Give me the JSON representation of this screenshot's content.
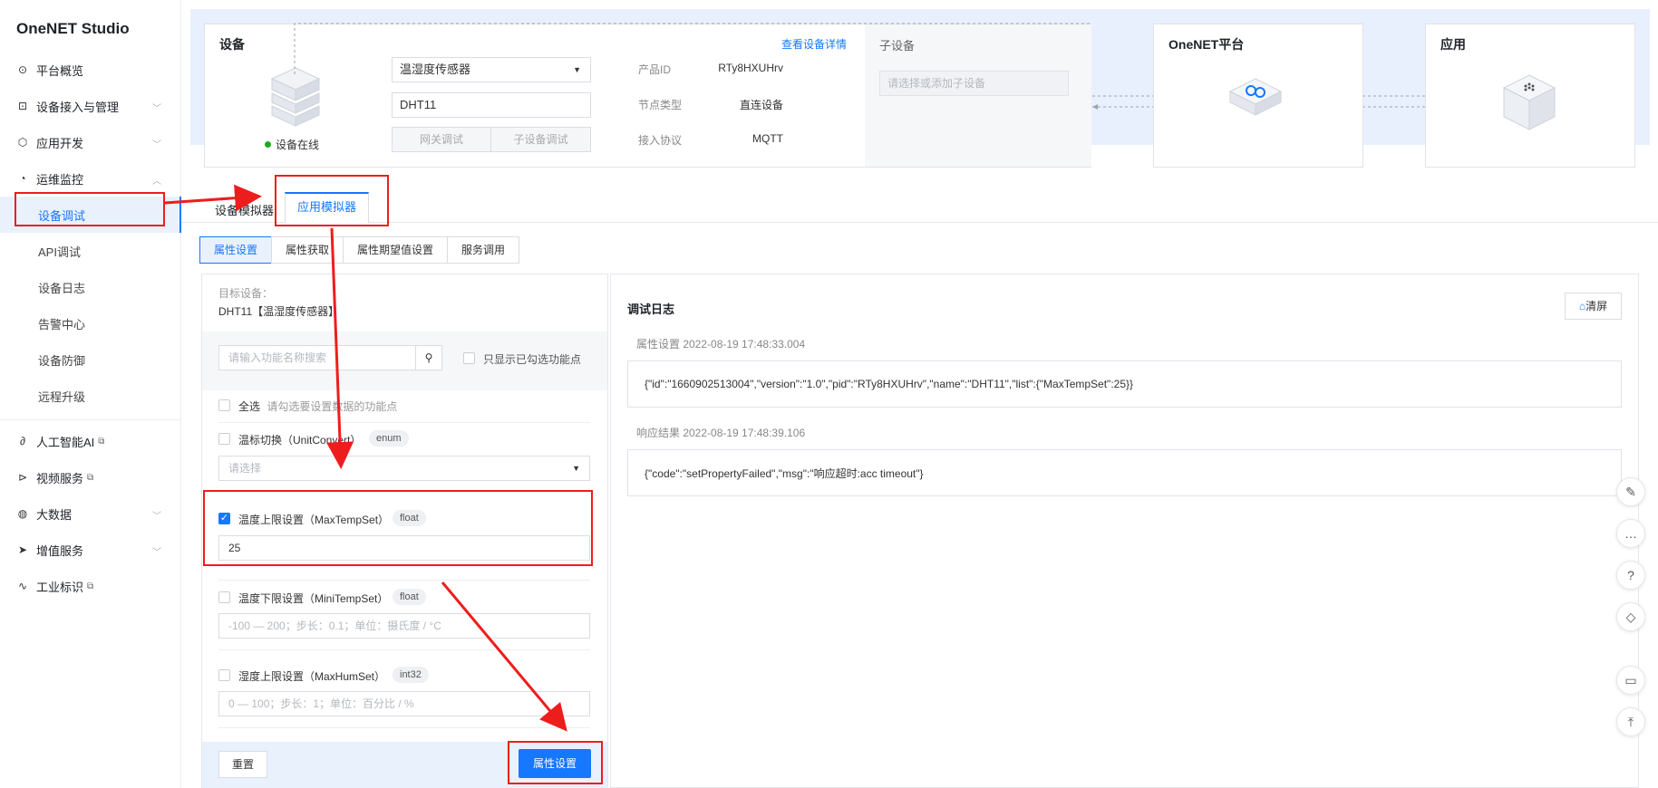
{
  "sidebar": {
    "brand": "OneNET Studio",
    "items": [
      {
        "label": "平台概览",
        "icon": "dashboard-icon"
      },
      {
        "label": "设备接入与管理",
        "icon": "device-manage-icon"
      },
      {
        "label": "应用开发",
        "icon": "cube-icon"
      },
      {
        "label": "运维监控",
        "icon": "pie-chart-icon"
      }
    ],
    "subitems": [
      "设备调试",
      "API调试",
      "设备日志",
      "告警中心",
      "设备防御",
      "远程升级"
    ],
    "items2": [
      {
        "label": "人工智能AI",
        "icon": "ai-icon"
      },
      {
        "label": "视频服务",
        "icon": "video-icon"
      },
      {
        "label": "大数据",
        "icon": "bigdata-icon"
      },
      {
        "label": "增值服务",
        "icon": "send-icon"
      },
      {
        "label": "工业标识",
        "icon": "industry-icon"
      }
    ]
  },
  "device_card": {
    "title": "设备",
    "detail_link": "查看设备详情",
    "status": "设备在线",
    "product_select": "温湿度传感器",
    "device_name": "DHT11",
    "gateway_btn": "网关调试",
    "subdevice_btn": "子设备调试",
    "product_id_label": "产品ID",
    "product_id": "RTy8HXUHrv",
    "node_type_label": "节点类型",
    "node_type": "直连设备",
    "protocol_label": "接入协议",
    "protocol": "MQTT"
  },
  "subdevice_card": {
    "title": "子设备",
    "placeholder": "请选择或添加子设备"
  },
  "platform_card": {
    "title": "OneNET平台"
  },
  "app_card": {
    "title": "应用"
  },
  "tabs": {
    "device_sim": "设备模拟器",
    "app_sim": "应用模拟器"
  },
  "subtabs": [
    "属性设置",
    "属性获取",
    "属性期望值设置",
    "服务调用"
  ],
  "form": {
    "target_label": "目标设备：",
    "target_value": "DHT11【温湿度传感器】",
    "search_placeholder": "请输入功能名称搜索",
    "only_checked": "只显示已勾选功能点",
    "select_all": "全选",
    "select_all_hint": "请勾选要设置数据的功能点",
    "props": [
      {
        "label": "温标切换（UnitConvert）",
        "type": "enum",
        "checked": false,
        "placeholder": "请选择",
        "value": ""
      },
      {
        "label": "温度上限设置（MaxTempSet）",
        "type": "float",
        "checked": true,
        "placeholder": "",
        "value": "25"
      },
      {
        "label": "温度下限设置（MiniTempSet）",
        "type": "float",
        "checked": false,
        "placeholder": "-100 — 200；步长：0.1；单位：摄氏度 / °C",
        "value": ""
      },
      {
        "label": "湿度上限设置（MaxHumSet）",
        "type": "int32",
        "checked": false,
        "placeholder": "0 — 100；步长：1；单位：百分比 / %",
        "value": ""
      }
    ],
    "reset_btn": "重置",
    "submit_btn": "属性设置"
  },
  "log": {
    "title": "调试日志",
    "clear_btn": "清屏",
    "entries": [
      {
        "header": "属性设置 2022-08-19 17:48:33.004",
        "body": "{\"id\":\"1660902513004\",\"version\":\"1.0\",\"pid\":\"RTy8HXUHrv\",\"name\":\"DHT11\",\"list\":{\"MaxTempSet\":25}}"
      },
      {
        "header": "响应结果 2022-08-19 17:48:39.106",
        "body": "{\"code\":\"setPropertyFailed\",\"msg\":\"响应超时:acc timeout\"}"
      }
    ]
  },
  "colors": {
    "accent": "#1677ff",
    "annotation": "#ee1d1d",
    "online": "#1aad19"
  }
}
